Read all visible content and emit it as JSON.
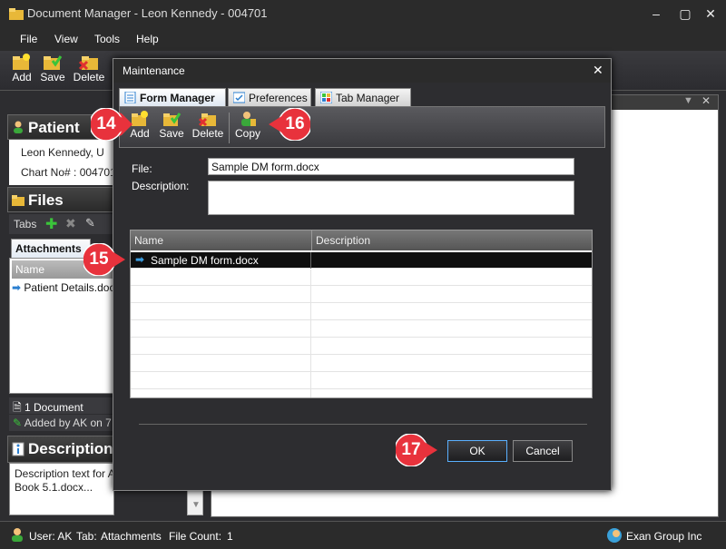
{
  "window": {
    "title": "Document Manager - Leon Kennedy - 004701"
  },
  "menu": [
    "File",
    "View",
    "Tools",
    "Help"
  ],
  "toolbar": {
    "add": "Add",
    "save": "Save",
    "delete": "Delete"
  },
  "left": {
    "patient_title": "Patient",
    "patient_name": "Leon Kennedy,  U",
    "chart_no": "Chart No# : 004701",
    "files_title": "Files",
    "tabs_label": "Tabs",
    "attachments_tab": "Attachments",
    "name_col": "Name",
    "file_item": "Patient Details.docx",
    "doc_count": "1 Document",
    "added_by": "Added by AK on 7",
    "description_title": "Description",
    "description_text_1": "Description text for A",
    "description_text_2": "Book 5.1.docx..."
  },
  "status": {
    "user": "User: AK",
    "tab": "Tab:",
    "tab_value": "Attachments",
    "file_count": "File Count:",
    "file_count_value": "1",
    "brand": "Exan Group Inc"
  },
  "dialog": {
    "title": "Maintenance",
    "tabs": [
      "Form Manager",
      "Preferences",
      "Tab Manager"
    ],
    "toolbar": {
      "add": "Add",
      "save": "Save",
      "delete": "Delete",
      "copy": "Copy"
    },
    "file_label": "File:",
    "file_value": "Sample DM form.docx",
    "description_label": "Description:",
    "description_value": "",
    "grid": {
      "columns": [
        "Name",
        "Description"
      ],
      "rows": [
        {
          "name": "Sample DM form.docx",
          "description": ""
        }
      ]
    },
    "ok": "OK",
    "cancel": "Cancel"
  },
  "callouts": {
    "c14": "14",
    "c15": "15",
    "c16": "16",
    "c17": "17"
  },
  "colors": {
    "callout": "#e8323c",
    "accent": "#5ab0ff"
  }
}
